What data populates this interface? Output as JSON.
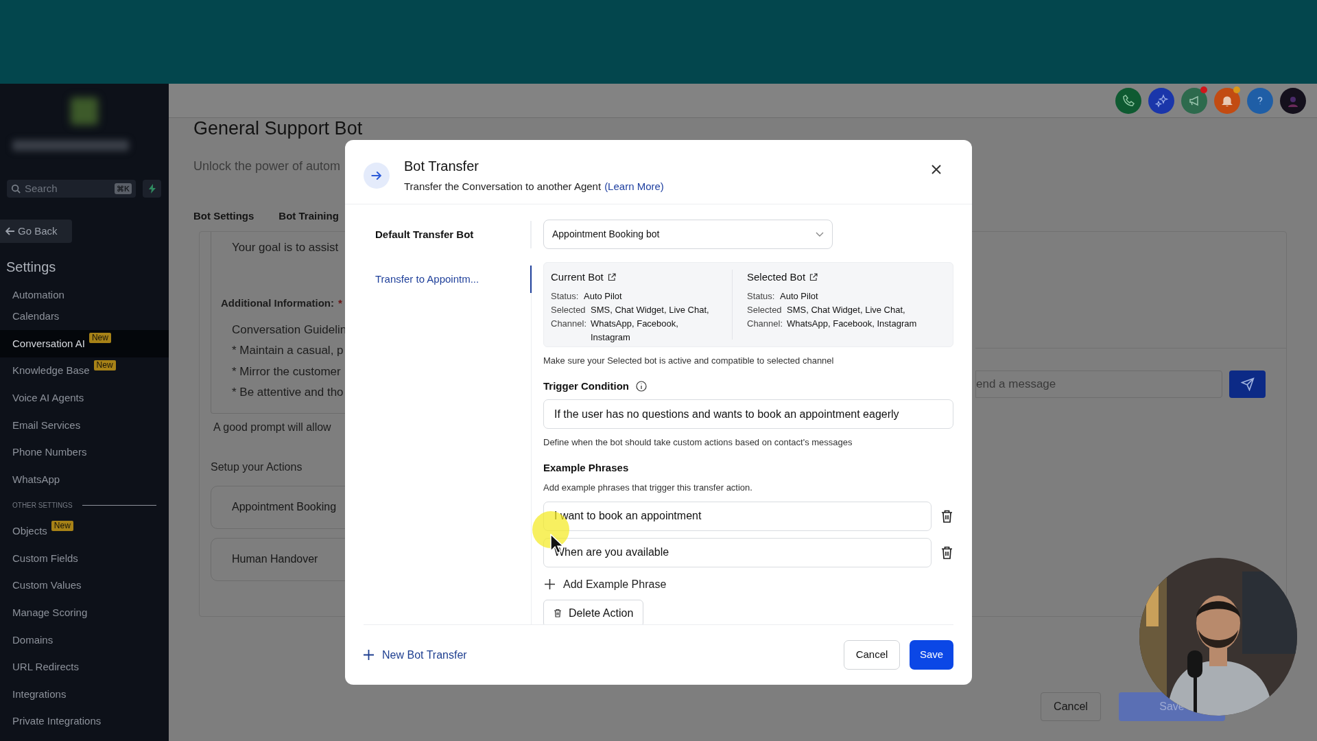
{
  "top_icons": [
    {
      "kind": "phone",
      "badge": false
    },
    {
      "kind": "sparkle",
      "badge": false
    },
    {
      "kind": "megaphone",
      "badge": true
    },
    {
      "kind": "bell",
      "badge": true
    },
    {
      "kind": "help",
      "badge": false
    },
    {
      "kind": "avatar",
      "badge": false
    }
  ],
  "sidebar": {
    "search": {
      "placeholder": "Search",
      "shortcut": "⌘K"
    },
    "back": "Go Back",
    "title": "Settings",
    "items": [
      {
        "label": "Automation",
        "selected": false
      },
      {
        "label": "Calendars",
        "selected": false
      },
      {
        "label": "Conversation AI",
        "selected": true,
        "badge": "New"
      },
      {
        "label": "Knowledge Base",
        "selected": false,
        "badge": "New"
      },
      {
        "label": "Voice AI Agents",
        "selected": false
      },
      {
        "label": "Email Services",
        "selected": false
      },
      {
        "label": "Phone Numbers",
        "selected": false
      },
      {
        "label": "WhatsApp",
        "selected": false
      }
    ],
    "section": "OTHER SETTINGS",
    "items2": [
      {
        "label": "Objects",
        "selected": false,
        "badge": "New"
      },
      {
        "label": "Custom Fields",
        "selected": false
      },
      {
        "label": "Custom Values",
        "selected": false
      },
      {
        "label": "Manage Scoring",
        "selected": false
      },
      {
        "label": "Domains",
        "selected": false
      },
      {
        "label": "URL Redirects",
        "selected": false
      },
      {
        "label": "Integrations",
        "selected": false
      },
      {
        "label": "Private Integrations",
        "selected": false
      }
    ]
  },
  "page": {
    "title": "General Support Bot",
    "subtitle": "Unlock the power of autom",
    "tabs": [
      "Bot Settings",
      "Bot Training"
    ]
  },
  "prompt": {
    "text": "Your goal is to assist",
    "additional_label": "Additional Information:",
    "required": "*",
    "lines": [
      "Conversation Guidelin",
      "* Maintain a casual, p",
      "* Mirror the customer",
      "* Be attentive and tho"
    ],
    "hint": "A good prompt will allow"
  },
  "actions": {
    "title": "Setup your Actions",
    "items": [
      "Appointment Booking",
      "Human Handover"
    ]
  },
  "chat": {
    "placeholder": "end a message"
  },
  "footer": {
    "cancel": "Cancel",
    "save": "Save"
  },
  "modal": {
    "title": "Bot Transfer",
    "subtitle": "Transfer the Conversation to another Agent",
    "link": "(Learn More)",
    "nav": [
      {
        "label": "Default Transfer Bot",
        "selected": false
      },
      {
        "label": "Transfer to Appointm...",
        "selected": true
      }
    ],
    "dropdown": "Appointment Booking bot",
    "bots": [
      {
        "title": "Current Bot",
        "status_label": "Status:",
        "status": "Auto Pilot",
        "channel_label": "Selected Channel:",
        "channels": "SMS, Chat Widget, Live Chat, WhatsApp, Facebook, Instagram"
      },
      {
        "title": "Selected Bot",
        "status_label": "Status:",
        "status": "Auto Pilot",
        "channel_label": "Selected Channel:",
        "channels": "SMS, Chat Widget, Live Chat, WhatsApp, Facebook, Instagram"
      }
    ],
    "note": "Make sure your Selected bot is active and compatible to selected channel",
    "trigger_label": "Trigger Condition",
    "trigger_value": "If the user has no questions and wants to book an appointment eagerly",
    "trigger_hint": "Define when the bot should take custom actions based on contact's messages",
    "phrases_label": "Example Phrases",
    "phrases_hint": "Add example phrases that trigger this transfer action.",
    "phrases": [
      "I want to book an appointment",
      "When are you available"
    ],
    "add_phrase": "Add Example Phrase",
    "delete_action": "Delete Action",
    "new_transfer": "New Bot Transfer",
    "cancel": "Cancel",
    "save": "Save"
  }
}
